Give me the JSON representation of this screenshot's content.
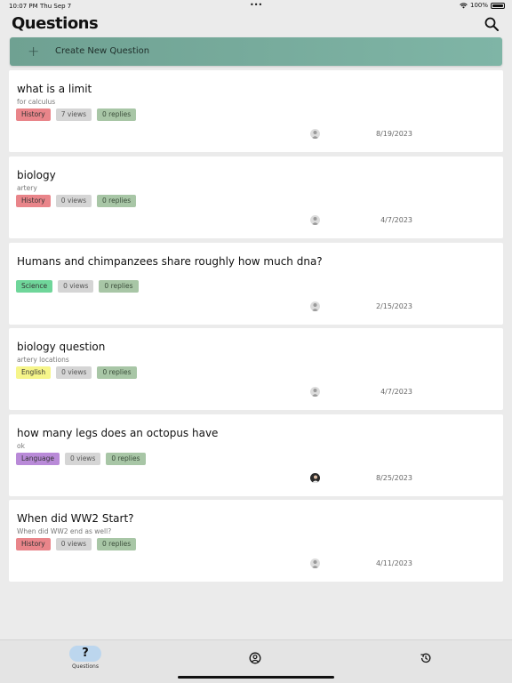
{
  "status": {
    "time": "10:07 PM",
    "date": "Thu Sep 7",
    "dots": "•••",
    "battery_pct": "100%"
  },
  "header": {
    "title": "Questions",
    "search_icon": "search-icon"
  },
  "create": {
    "plus": "+",
    "label": "Create New Question"
  },
  "colors": {
    "accent": "#7fb5a6",
    "history": "#e9858a",
    "science": "#6fd69a",
    "english": "#f6f58a",
    "language": "#b98ad8",
    "views": "#d5d5d5",
    "replies": "#a8c6a6"
  },
  "questions": [
    {
      "title": "what is a limit",
      "subtitle": "for calculus",
      "tag": "History",
      "views": "7 views",
      "replies": "0 replies",
      "date": "8/19/2023"
    },
    {
      "title": "biology",
      "subtitle": "artery",
      "tag": "History",
      "views": "0 views",
      "replies": "0 replies",
      "date": "4/7/2023"
    },
    {
      "title": "Humans and chimpanzees share roughly how much dna?",
      "subtitle": "",
      "tag": "Science",
      "views": "0 views",
      "replies": "0 replies",
      "date": "2/15/2023"
    },
    {
      "title": "biology question",
      "subtitle": "artery locations",
      "tag": "English",
      "views": "0 views",
      "replies": "0 replies",
      "date": "4/7/2023"
    },
    {
      "title": "how many legs does an octopus have",
      "subtitle": "ok",
      "tag": "Language",
      "views": "0 views",
      "replies": "0 replies",
      "date": "8/25/2023"
    },
    {
      "title": "When did WW2 Start?",
      "subtitle": "When did WW2 end as well?",
      "tag": "History",
      "views": "0 views",
      "replies": "0 replies",
      "date": "4/11/2023"
    }
  ],
  "tabbar": {
    "questions_glyph": "?",
    "questions_label": "Questions",
    "profile_icon": "profile-icon",
    "history_icon": "history-icon"
  }
}
